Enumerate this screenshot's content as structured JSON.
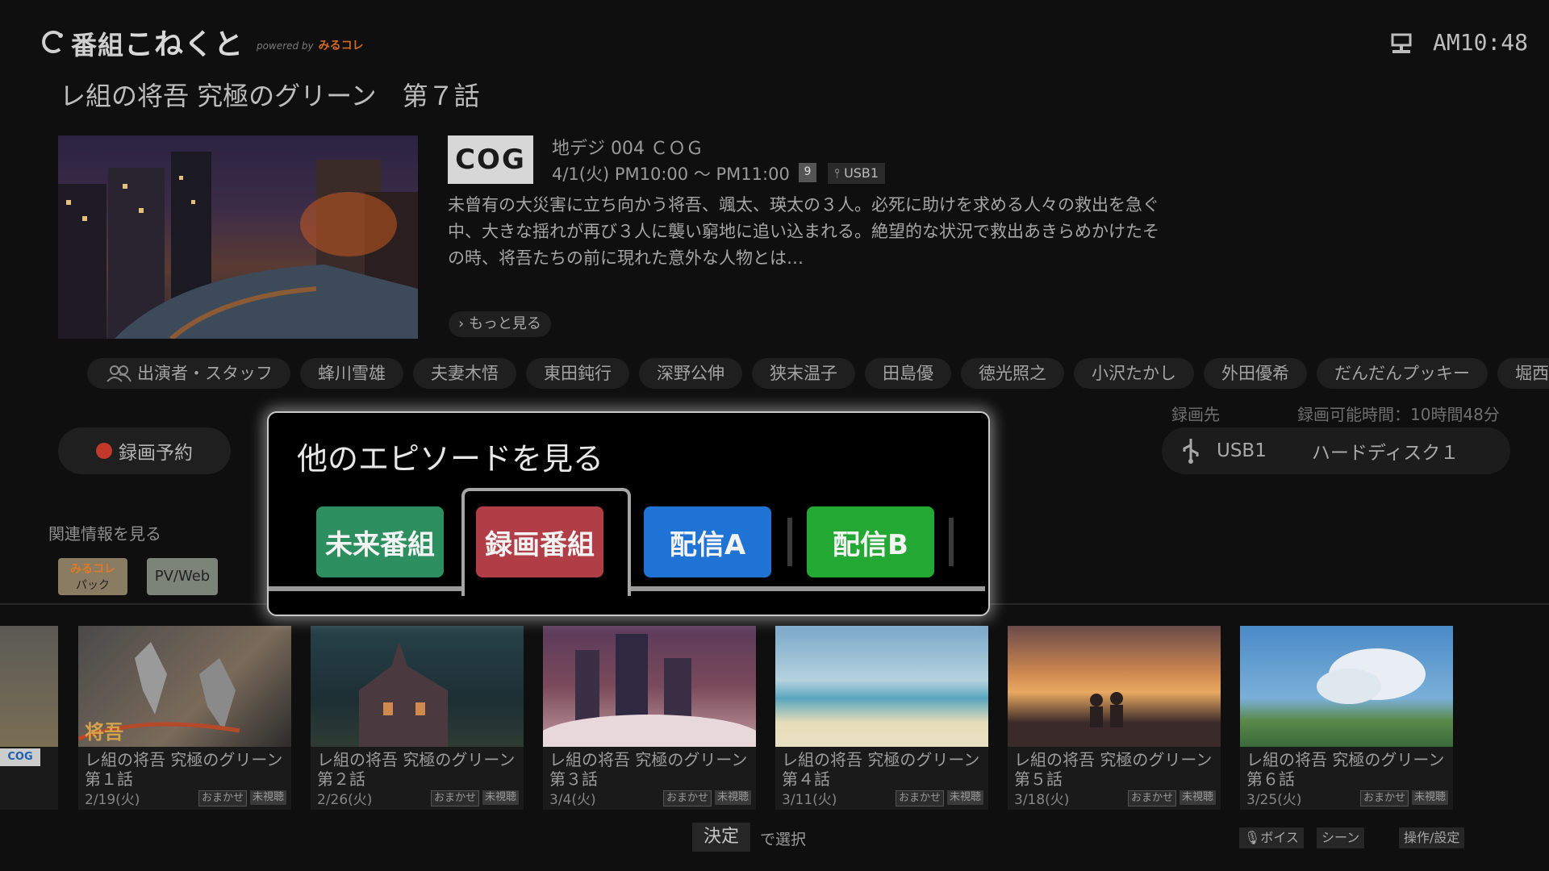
{
  "header": {
    "logo_prefix": "番組",
    "logo_main": "こねくと",
    "logo_powered": "powered by",
    "logo_partner": "みるコレ",
    "clock": "AM10:48"
  },
  "program": {
    "title": "レ組の将吾 究極のグリーン　第７話",
    "station_logo": "COG",
    "channel": "地デジ 004 ＣＯＧ",
    "airtime": "4/1(火) PM10:00 〜 PM11:00",
    "badge": "9",
    "usb": "USB1",
    "description": "未曾有の大災害に立ち向かう将吾、颯太、瑛太の３人。必死に助けを求める人々の救出を急ぐ中、大きな揺れが再び３人に襲い窮地に追い込まれる。絶望的な状況で救出あきらめかけたその時、将吾たちの前に現れた意外な人物とは…",
    "more_label": "もっと見る"
  },
  "cast": [
    "出演者・スタッフ",
    "蜂川雪雄",
    "夫妻木悟",
    "東田鈍行",
    "深野公伸",
    "狭末温子",
    "田島優",
    "徳光照之",
    "小沢たかし",
    "外田優希",
    "だんだんプッキー",
    "堀西美紀"
  ],
  "recording": {
    "dest_label": "録画先",
    "time_label": "録画可能時間：10時間48分",
    "reserve_label": "録画予約",
    "dest_usb": "USB1",
    "dest_disk": "ハードディスク１"
  },
  "related": {
    "label": "関連情報を見る",
    "btn1_top": "みるコレ",
    "btn1_bottom": "パック",
    "btn2": "PV/Web"
  },
  "popup": {
    "title": "他のエピソードを見る",
    "buttons": [
      "未来番組",
      "録画番組",
      "配信A",
      "配信B"
    ],
    "selected_index": 1
  },
  "episodes": [
    {
      "title": "レ組の将吾 究極のグリーン　第１話",
      "date": "2/19(火)",
      "tag1": "おまかせ",
      "tag2": "未視聴"
    },
    {
      "title": "レ組の将吾 究極のグリーン　第２話",
      "date": "2/26(火)",
      "tag1": "おまかせ",
      "tag2": "未視聴"
    },
    {
      "title": "レ組の将吾 究極のグリーン　第３話",
      "date": "3/4(火)",
      "tag1": "おまかせ",
      "tag2": "未視聴"
    },
    {
      "title": "レ組の将吾 究極のグリーン　第４話",
      "date": "3/11(火)",
      "tag1": "おまかせ",
      "tag2": "未視聴"
    },
    {
      "title": "レ組の将吾 究極のグリーン　第５話",
      "date": "3/18(火)",
      "tag1": "おまかせ",
      "tag2": "未視聴"
    },
    {
      "title": "レ組の将吾 究極のグリーン　第６話",
      "date": "3/25(火)",
      "tag1": "おまかせ",
      "tag2": "未視聴"
    }
  ],
  "partial_card_overlay": "将吾",
  "footer": {
    "ok_label": "決定",
    "ok_hint": "で選択",
    "voice": "ボイス",
    "scene": "シーン",
    "settings": "操作/設定"
  },
  "colors": {
    "accent_green": "#2d8f60",
    "accent_red": "#b13e46",
    "accent_blue": "#1f73d4",
    "accent_bright_green": "#23a834"
  }
}
